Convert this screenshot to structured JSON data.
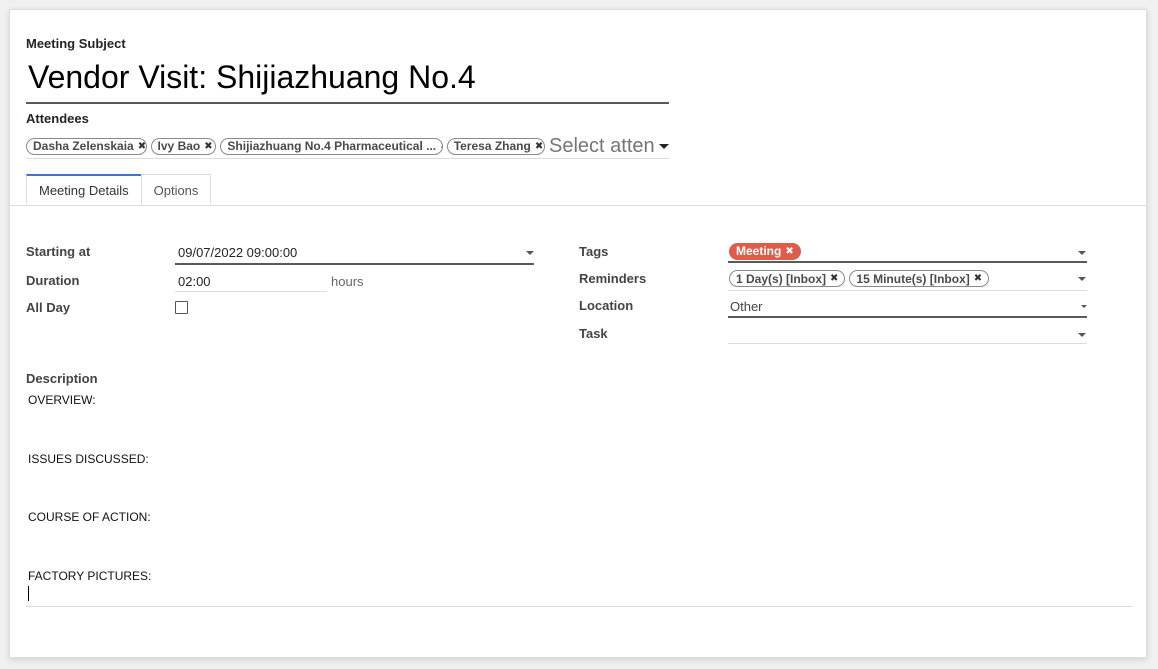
{
  "subject": {
    "label": "Meeting Subject",
    "title": "Vendor Visit: Shijiazhuang No.4"
  },
  "attendees": {
    "label": "Attendees",
    "tags": [
      "Dasha Zelenskaia",
      "Ivy Bao",
      "Shijiazhuang No.4 Pharmaceutical ...",
      "Teresa Zhang"
    ],
    "placeholder": "Select atten"
  },
  "tabs": [
    "Meeting Details",
    "Options"
  ],
  "left_fields": {
    "starting_at": {
      "label": "Starting at",
      "value": "09/07/2022 09:00:00"
    },
    "duration": {
      "label": "Duration",
      "value": "02:00",
      "unit": "hours"
    },
    "all_day": {
      "label": "All Day",
      "checked": false
    }
  },
  "right_fields": {
    "tags": {
      "label": "Tags",
      "items": [
        "Meeting"
      ]
    },
    "reminders": {
      "label": "Reminders",
      "items": [
        "1 Day(s) [Inbox]",
        "15 Minute(s) [Inbox]"
      ]
    },
    "location": {
      "label": "Location",
      "value": "Other"
    },
    "task": {
      "label": "Task",
      "value": ""
    }
  },
  "description": {
    "label": "Description",
    "lines": [
      "OVERVIEW:",
      "ISSUES DISCUSSED:",
      "COURSE OF ACTION:",
      "FACTORY PICTURES:"
    ]
  },
  "icons": {
    "remove": "x-icon",
    "dropdown": "caret-down-icon"
  },
  "colors": {
    "tag_meeting": "#e05c4a",
    "active_tab": "#3a78c4"
  }
}
